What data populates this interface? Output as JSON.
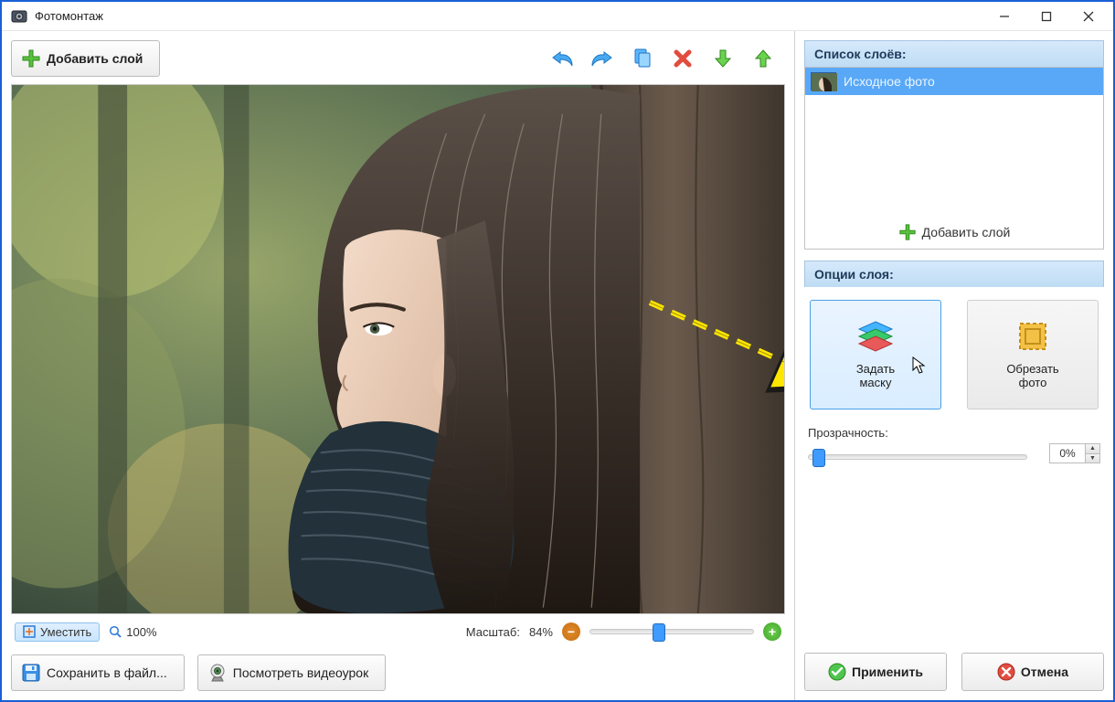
{
  "window": {
    "title": "Фотомонтаж"
  },
  "toolbar": {
    "add_layer": "Добавить слой"
  },
  "zoom": {
    "fit_label": "Уместить",
    "percent_100": "100%",
    "scale_label": "Масштаб:",
    "scale_value": "84%"
  },
  "bottom": {
    "save_label": "Сохранить в файл...",
    "video_label": "Посмотреть видеоурок"
  },
  "layers": {
    "header": "Список слоёв:",
    "items": [
      {
        "label": "Исходное фото"
      }
    ],
    "add_label": "Добавить слой"
  },
  "options": {
    "header": "Опции слоя:",
    "mask_label": "Задать\nмаску",
    "crop_label": "Обрезать\nфото"
  },
  "opacity": {
    "label": "Прозрачность:",
    "value": "0%"
  },
  "actions": {
    "apply": "Применить",
    "cancel": "Отмена"
  }
}
